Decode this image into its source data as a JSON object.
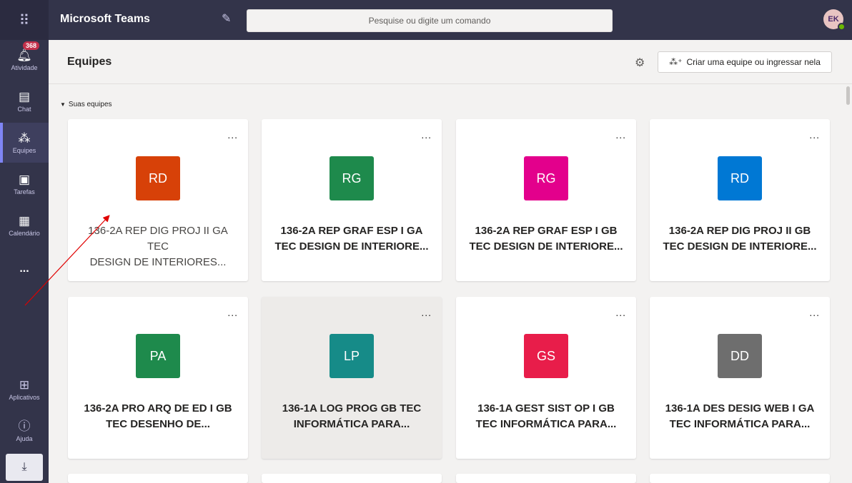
{
  "app": {
    "title": "Microsoft Teams",
    "launcher_icon": "waffle-icon",
    "compose_icon": "compose-icon"
  },
  "search": {
    "placeholder": "Pesquise ou digite um comando"
  },
  "user": {
    "initials": "EK",
    "presence": "available",
    "presence_color": "#6bb700"
  },
  "rail": {
    "items": [
      {
        "label": "Atividade",
        "icon": "bell-icon",
        "badge": "368"
      },
      {
        "label": "Chat",
        "icon": "chat-icon"
      },
      {
        "label": "Equipes",
        "icon": "teams-icon",
        "active": true
      },
      {
        "label": "Tarefas",
        "icon": "tasks-icon"
      },
      {
        "label": "Calendário",
        "icon": "calendar-icon"
      }
    ],
    "more": "...",
    "bottom": [
      {
        "label": "Aplicativos",
        "icon": "apps-icon"
      },
      {
        "label": "Ajuda",
        "icon": "help-icon"
      }
    ],
    "download_icon": "download-icon"
  },
  "header": {
    "title": "Equipes",
    "create_button": "Criar uma equipe ou ingressar nela"
  },
  "section": {
    "label": "Suas equipes"
  },
  "teams": [
    {
      "initials": "RD",
      "color": "#d74108",
      "name_line1": "136-2A REP DIG PROJ II GA TEC",
      "name_line2": "DESIGN DE INTERIORES..."
    },
    {
      "initials": "RG",
      "color": "#1e8a4c",
      "name_line1": "136-2A REP GRAF ESP I GA",
      "name_line2": "TEC DESIGN DE INTERIORE..."
    },
    {
      "initials": "RG",
      "color": "#e3008c",
      "name_line1": "136-2A REP GRAF ESP I GB",
      "name_line2": "TEC DESIGN DE INTERIORE..."
    },
    {
      "initials": "RD",
      "color": "#0078d4",
      "name_line1": "136-2A REP DIG PROJ II GB",
      "name_line2": "TEC DESIGN DE INTERIORE..."
    },
    {
      "initials": "PA",
      "color": "#1e8a4c",
      "name_line1": "136-2A PRO ARQ DE ED I GB",
      "name_line2": "TEC DESENHO DE..."
    },
    {
      "initials": "LP",
      "color": "#168b88",
      "name_line1": "136-1A LOG PROG GB TEC",
      "name_line2": "INFORMÁTICA PARA..."
    },
    {
      "initials": "GS",
      "color": "#e81d4a",
      "name_line1": "136-1A GEST SIST OP I GB",
      "name_line2": "TEC INFORMÁTICA PARA..."
    },
    {
      "initials": "DD",
      "color": "#6e6e6e",
      "name_line1": "136-1A DES DESIG WEB I GA",
      "name_line2": "TEC INFORMÁTICA PARA..."
    }
  ],
  "card_more": "...",
  "annotation": {
    "color": "#e00000"
  }
}
